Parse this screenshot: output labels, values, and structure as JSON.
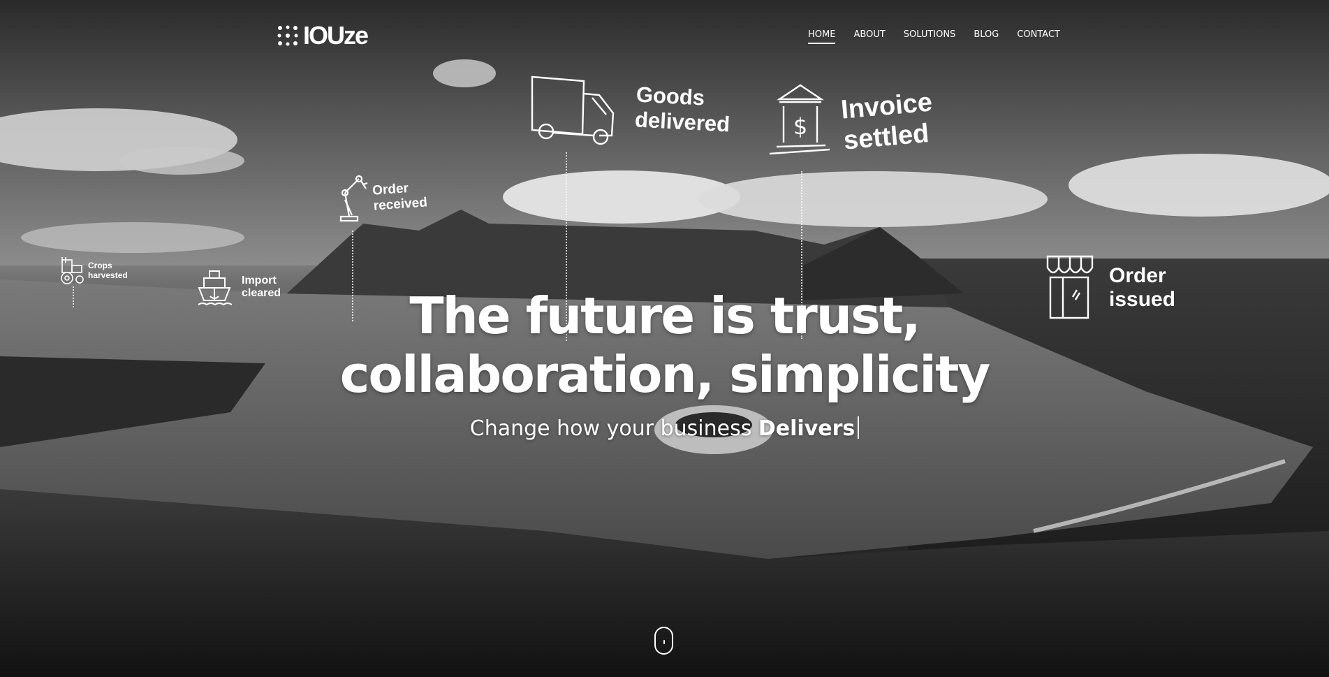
{
  "brand": {
    "name": "IOUze"
  },
  "nav": {
    "items": [
      {
        "label": "HOME",
        "active": true
      },
      {
        "label": "ABOUT",
        "active": false
      },
      {
        "label": "SOLUTIONS",
        "active": false
      },
      {
        "label": "BLOG",
        "active": false
      },
      {
        "label": "CONTACT",
        "active": false
      }
    ]
  },
  "steps": {
    "crops": {
      "label": "Crops\nharvested",
      "icon": "tractor-icon"
    },
    "import": {
      "label": "Import\ncleared",
      "icon": "ship-icon"
    },
    "order_received": {
      "label": "Order\nreceived",
      "icon": "robot-arm-icon"
    },
    "goods": {
      "label": "Goods\ndelivered",
      "icon": "truck-icon"
    },
    "invoice": {
      "label": "Invoice\nsettled",
      "icon": "bank-icon"
    },
    "order_issued": {
      "label": "Order\nissued",
      "icon": "storefront-icon"
    }
  },
  "hero": {
    "headline_line1": "The future is trust,",
    "headline_line2": "collaboration, simplicity",
    "subline_prefix": "Change how your business ",
    "subline_emphasis": "Delivers"
  },
  "colors": {
    "text": "#ffffff",
    "background": "#3a3a3a"
  }
}
